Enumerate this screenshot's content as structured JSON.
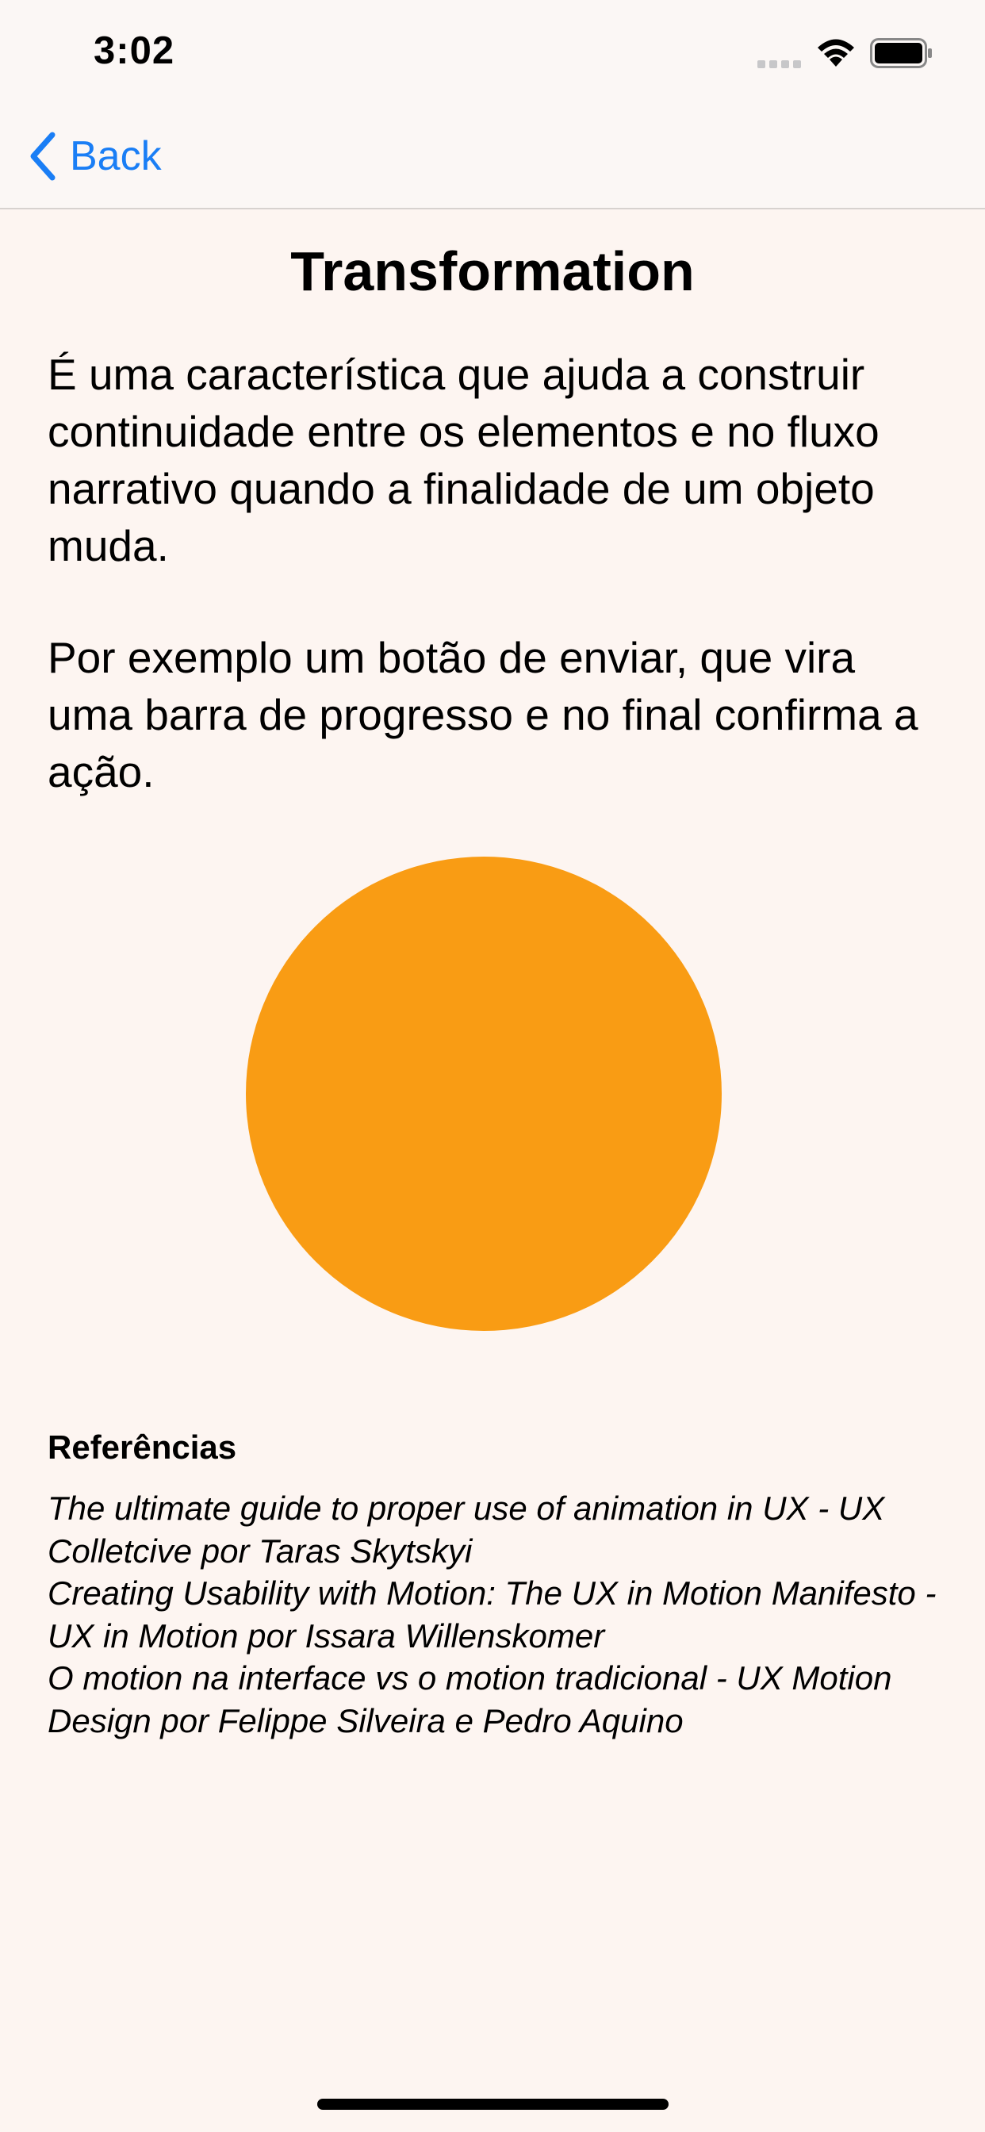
{
  "status_bar": {
    "time": "3:02"
  },
  "nav": {
    "back_label": "Back"
  },
  "content": {
    "title": "Transformation",
    "paragraph_1": "É uma característica que ajuda a construir continuidade entre os elementos e no fluxo narrativo quando a finalidade de um objeto muda.",
    "paragraph_2": "Por exemplo um botão de enviar, que vira uma barra de progresso e no final confirma a ação.",
    "circle_color": "#F99C14"
  },
  "references": {
    "title": "Referências",
    "items": [
      "The ultimate guide to proper use of animation in UX - UX Colletcive por Taras Skytskyi",
      "Creating Usability with Motion: The UX in Motion Manifesto - UX in Motion por Issara Willenskomer",
      "O motion na interface vs o motion tradicional - UX Motion Design por Felippe Silveira e Pedro Aquino"
    ]
  },
  "icons": {
    "back": "chevron-left-icon",
    "wifi": "wifi-icon",
    "battery": "battery-icon",
    "signal": "cellular-signal-icon"
  },
  "colors": {
    "background": "#FDF5F1",
    "accent": "#1A7EF5",
    "circle": "#F99C14"
  }
}
